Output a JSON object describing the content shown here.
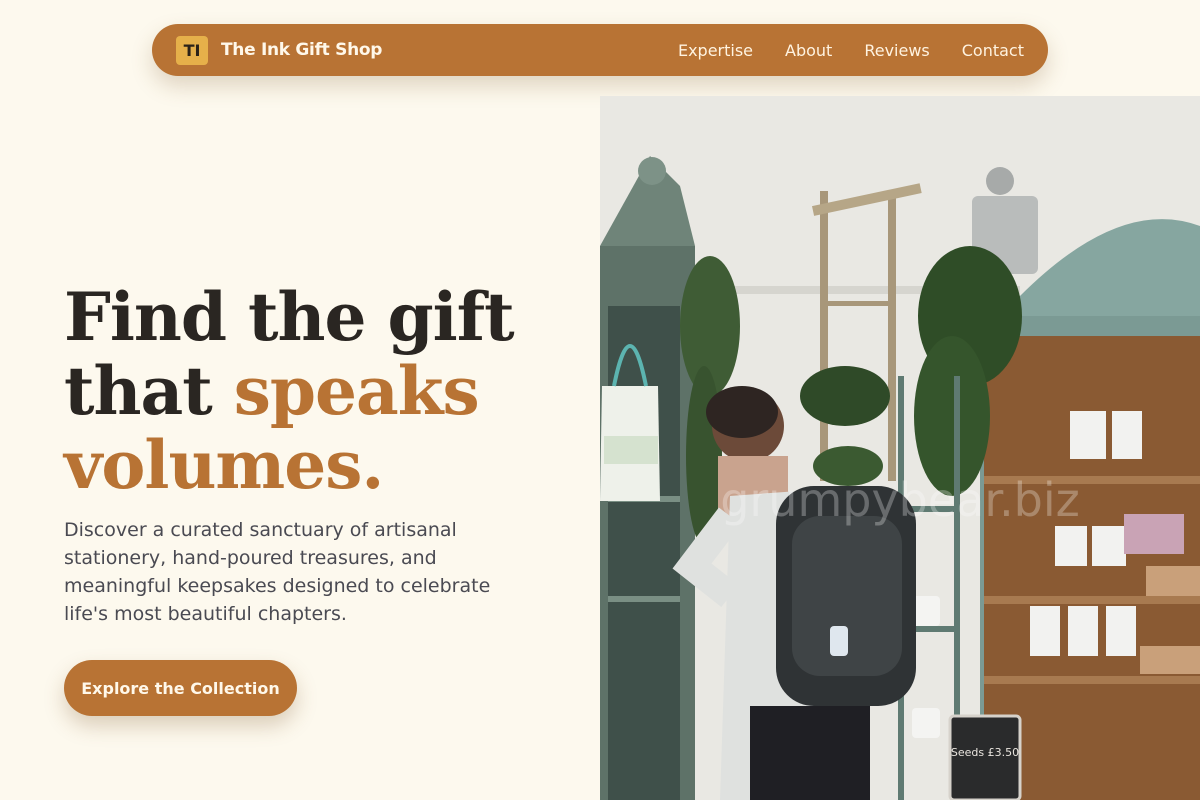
{
  "nav": {
    "logo_initials": "TI",
    "brand_name": "The Ink Gift Shop",
    "links": [
      "Expertise",
      "About",
      "Reviews",
      "Contact"
    ]
  },
  "hero": {
    "title_line1": "Find the gift",
    "title_line2_plain": "that ",
    "title_line2_accent": "speaks",
    "title_line3_accent": "volumes.",
    "body": "Discover a curated sanctuary of artisanal stationery, hand-poured treasures, and meaningful keepsakes designed to celebrate life's most beautiful chapters.",
    "cta_label": "Explore the Collection"
  },
  "image": {
    "watermark": "grumpybear.biz",
    "chalkboard_text": "Seeds £3.50"
  },
  "colors": {
    "accent": "#b87334",
    "logo_badge": "#e6b04a",
    "background": "#fdf9ee",
    "heading": "#2a2622",
    "body_text": "#4a4a52"
  }
}
